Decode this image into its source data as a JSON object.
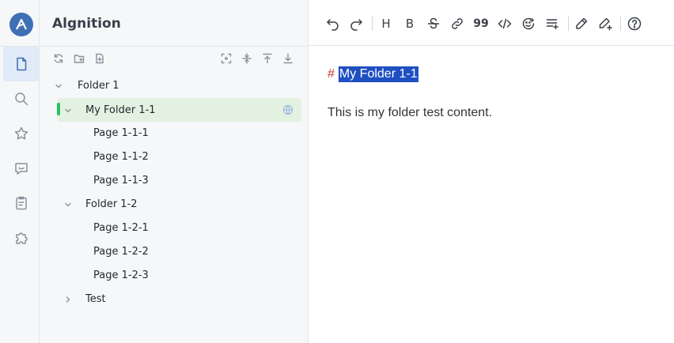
{
  "app": {
    "name": "Algnition",
    "logo_letter": "A"
  },
  "rail": {
    "items": [
      "files-icon",
      "search-icon",
      "star-icon",
      "comment-icon",
      "clipboard-icon",
      "plugin-icon"
    ],
    "active": "files-icon"
  },
  "sidebar_tools": {
    "left": [
      "refresh-icon",
      "new-folder-icon",
      "new-page-icon"
    ],
    "right": [
      "locate-icon",
      "collapse-all-icon",
      "import-icon",
      "export-icon"
    ]
  },
  "tree": [
    {
      "label": "Folder 1",
      "expanded": true,
      "level": 0
    },
    {
      "label": "My Folder 1-1",
      "expanded": true,
      "level": 1,
      "selected": true
    },
    {
      "label": "Page 1-1-1",
      "level": 2
    },
    {
      "label": "Page 1-1-2",
      "level": 2
    },
    {
      "label": "Page 1-1-3",
      "level": 2
    },
    {
      "label": "Folder 1-2",
      "expanded": true,
      "level": 1
    },
    {
      "label": "Page 1-2-1",
      "level": 2
    },
    {
      "label": "Page 1-2-2",
      "level": 2
    },
    {
      "label": "Page 1-2-3",
      "level": 2
    },
    {
      "label": "Test",
      "expanded": false,
      "level": 1
    }
  ],
  "toolbar": {
    "buttons": [
      "undo-icon",
      "redo-icon",
      "heading-icon",
      "bold-icon",
      "strikethrough-icon",
      "link-icon",
      "quote-icon",
      "code-icon",
      "emoji-icon",
      "list-add-icon",
      "edit-icon",
      "edit-plus-icon",
      "help-icon"
    ],
    "heading_glyph": "H",
    "bold_glyph": "B",
    "quote_glyph": "99"
  },
  "editor": {
    "heading_marker": "#",
    "heading_text": "My Folder 1-1",
    "paragraph": "This is my folder test content."
  },
  "colors": {
    "accent": "#3f6fb4",
    "selection_bg": "#e3f1e1",
    "selection_marker": "#22c55e",
    "text_highlight": "#1f4fc1",
    "hash": "#c0392b"
  }
}
